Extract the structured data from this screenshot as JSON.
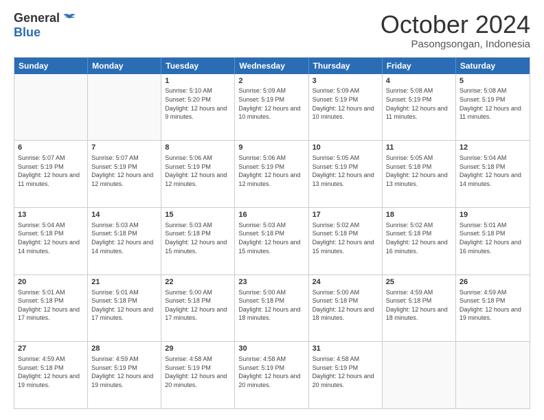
{
  "logo": {
    "general": "General",
    "blue": "Blue"
  },
  "header": {
    "month": "October 2024",
    "location": "Pasongsongan, Indonesia"
  },
  "weekdays": [
    "Sunday",
    "Monday",
    "Tuesday",
    "Wednesday",
    "Thursday",
    "Friday",
    "Saturday"
  ],
  "weeks": [
    [
      {
        "day": "",
        "sunrise": "",
        "sunset": "",
        "daylight": ""
      },
      {
        "day": "",
        "sunrise": "",
        "sunset": "",
        "daylight": ""
      },
      {
        "day": "1",
        "sunrise": "Sunrise: 5:10 AM",
        "sunset": "Sunset: 5:20 PM",
        "daylight": "Daylight: 12 hours and 9 minutes."
      },
      {
        "day": "2",
        "sunrise": "Sunrise: 5:09 AM",
        "sunset": "Sunset: 5:19 PM",
        "daylight": "Daylight: 12 hours and 10 minutes."
      },
      {
        "day": "3",
        "sunrise": "Sunrise: 5:09 AM",
        "sunset": "Sunset: 5:19 PM",
        "daylight": "Daylight: 12 hours and 10 minutes."
      },
      {
        "day": "4",
        "sunrise": "Sunrise: 5:08 AM",
        "sunset": "Sunset: 5:19 PM",
        "daylight": "Daylight: 12 hours and 11 minutes."
      },
      {
        "day": "5",
        "sunrise": "Sunrise: 5:08 AM",
        "sunset": "Sunset: 5:19 PM",
        "daylight": "Daylight: 12 hours and 11 minutes."
      }
    ],
    [
      {
        "day": "6",
        "sunrise": "Sunrise: 5:07 AM",
        "sunset": "Sunset: 5:19 PM",
        "daylight": "Daylight: 12 hours and 11 minutes."
      },
      {
        "day": "7",
        "sunrise": "Sunrise: 5:07 AM",
        "sunset": "Sunset: 5:19 PM",
        "daylight": "Daylight: 12 hours and 12 minutes."
      },
      {
        "day": "8",
        "sunrise": "Sunrise: 5:06 AM",
        "sunset": "Sunset: 5:19 PM",
        "daylight": "Daylight: 12 hours and 12 minutes."
      },
      {
        "day": "9",
        "sunrise": "Sunrise: 5:06 AM",
        "sunset": "Sunset: 5:19 PM",
        "daylight": "Daylight: 12 hours and 12 minutes."
      },
      {
        "day": "10",
        "sunrise": "Sunrise: 5:05 AM",
        "sunset": "Sunset: 5:19 PM",
        "daylight": "Daylight: 12 hours and 13 minutes."
      },
      {
        "day": "11",
        "sunrise": "Sunrise: 5:05 AM",
        "sunset": "Sunset: 5:18 PM",
        "daylight": "Daylight: 12 hours and 13 minutes."
      },
      {
        "day": "12",
        "sunrise": "Sunrise: 5:04 AM",
        "sunset": "Sunset: 5:18 PM",
        "daylight": "Daylight: 12 hours and 14 minutes."
      }
    ],
    [
      {
        "day": "13",
        "sunrise": "Sunrise: 5:04 AM",
        "sunset": "Sunset: 5:18 PM",
        "daylight": "Daylight: 12 hours and 14 minutes."
      },
      {
        "day": "14",
        "sunrise": "Sunrise: 5:03 AM",
        "sunset": "Sunset: 5:18 PM",
        "daylight": "Daylight: 12 hours and 14 minutes."
      },
      {
        "day": "15",
        "sunrise": "Sunrise: 5:03 AM",
        "sunset": "Sunset: 5:18 PM",
        "daylight": "Daylight: 12 hours and 15 minutes."
      },
      {
        "day": "16",
        "sunrise": "Sunrise: 5:03 AM",
        "sunset": "Sunset: 5:18 PM",
        "daylight": "Daylight: 12 hours and 15 minutes."
      },
      {
        "day": "17",
        "sunrise": "Sunrise: 5:02 AM",
        "sunset": "Sunset: 5:18 PM",
        "daylight": "Daylight: 12 hours and 15 minutes."
      },
      {
        "day": "18",
        "sunrise": "Sunrise: 5:02 AM",
        "sunset": "Sunset: 5:18 PM",
        "daylight": "Daylight: 12 hours and 16 minutes."
      },
      {
        "day": "19",
        "sunrise": "Sunrise: 5:01 AM",
        "sunset": "Sunset: 5:18 PM",
        "daylight": "Daylight: 12 hours and 16 minutes."
      }
    ],
    [
      {
        "day": "20",
        "sunrise": "Sunrise: 5:01 AM",
        "sunset": "Sunset: 5:18 PM",
        "daylight": "Daylight: 12 hours and 17 minutes."
      },
      {
        "day": "21",
        "sunrise": "Sunrise: 5:01 AM",
        "sunset": "Sunset: 5:18 PM",
        "daylight": "Daylight: 12 hours and 17 minutes."
      },
      {
        "day": "22",
        "sunrise": "Sunrise: 5:00 AM",
        "sunset": "Sunset: 5:18 PM",
        "daylight": "Daylight: 12 hours and 17 minutes."
      },
      {
        "day": "23",
        "sunrise": "Sunrise: 5:00 AM",
        "sunset": "Sunset: 5:18 PM",
        "daylight": "Daylight: 12 hours and 18 minutes."
      },
      {
        "day": "24",
        "sunrise": "Sunrise: 5:00 AM",
        "sunset": "Sunset: 5:18 PM",
        "daylight": "Daylight: 12 hours and 18 minutes."
      },
      {
        "day": "25",
        "sunrise": "Sunrise: 4:59 AM",
        "sunset": "Sunset: 5:18 PM",
        "daylight": "Daylight: 12 hours and 18 minutes."
      },
      {
        "day": "26",
        "sunrise": "Sunrise: 4:59 AM",
        "sunset": "Sunset: 5:18 PM",
        "daylight": "Daylight: 12 hours and 19 minutes."
      }
    ],
    [
      {
        "day": "27",
        "sunrise": "Sunrise: 4:59 AM",
        "sunset": "Sunset: 5:18 PM",
        "daylight": "Daylight: 12 hours and 19 minutes."
      },
      {
        "day": "28",
        "sunrise": "Sunrise: 4:59 AM",
        "sunset": "Sunset: 5:19 PM",
        "daylight": "Daylight: 12 hours and 19 minutes."
      },
      {
        "day": "29",
        "sunrise": "Sunrise: 4:58 AM",
        "sunset": "Sunset: 5:19 PM",
        "daylight": "Daylight: 12 hours and 20 minutes."
      },
      {
        "day": "30",
        "sunrise": "Sunrise: 4:58 AM",
        "sunset": "Sunset: 5:19 PM",
        "daylight": "Daylight: 12 hours and 20 minutes."
      },
      {
        "day": "31",
        "sunrise": "Sunrise: 4:58 AM",
        "sunset": "Sunset: 5:19 PM",
        "daylight": "Daylight: 12 hours and 20 minutes."
      },
      {
        "day": "",
        "sunrise": "",
        "sunset": "",
        "daylight": ""
      },
      {
        "day": "",
        "sunrise": "",
        "sunset": "",
        "daylight": ""
      }
    ]
  ]
}
